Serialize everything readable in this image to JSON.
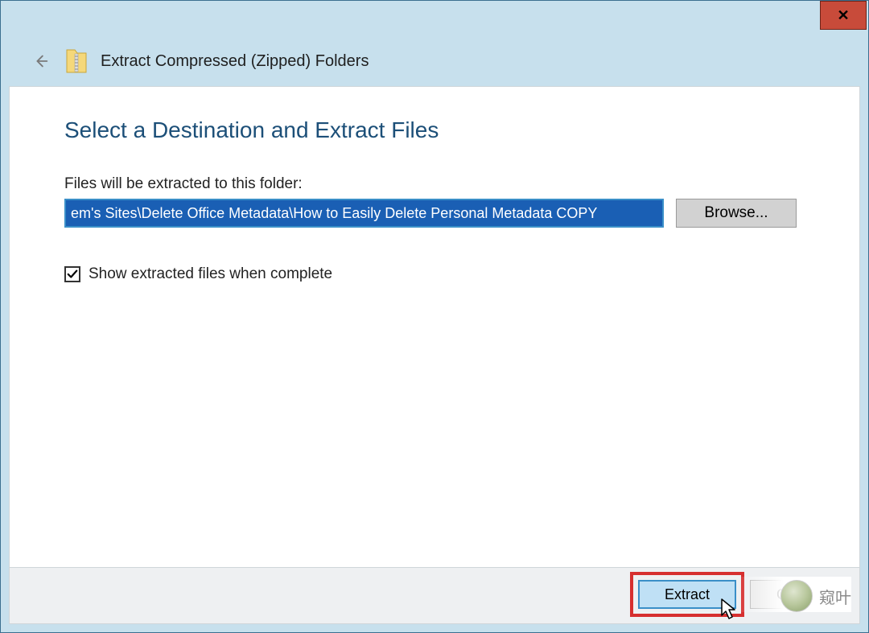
{
  "titlebar": {
    "close_symbol": "✕"
  },
  "header": {
    "title": "Extract Compressed (Zipped) Folders"
  },
  "main": {
    "heading": "Select a Destination and Extract Files",
    "folder_label": "Files will be extracted to this folder:",
    "path_value": "em's Sites\\Delete Office Metadata\\How to Easily Delete Personal Metadata COPY",
    "browse_label": "Browse...",
    "checkbox_label": "Show extracted files when complete",
    "checkbox_checked": true
  },
  "buttons": {
    "extract": "Extract",
    "cancel": "Cancel"
  },
  "watermark": {
    "text": "窥叶"
  }
}
